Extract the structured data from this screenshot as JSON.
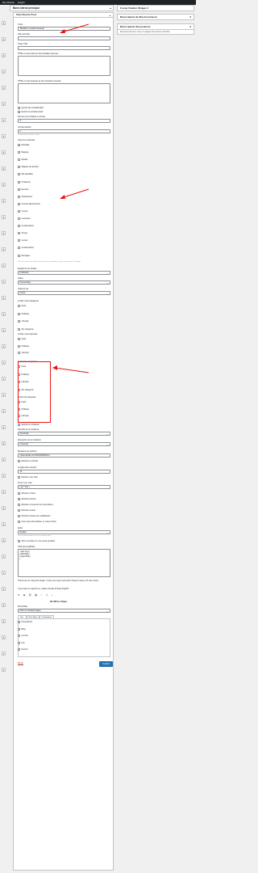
{
  "adminbar": {
    "items": [
      "Mis Librerías",
      "Analytic"
    ]
  },
  "left_icons": [
    {
      "glyph": "▾"
    },
    {
      "glyph": "▾"
    },
    {
      "glyph": "▾"
    }
  ],
  "area": {
    "title": "Barra lateral principal"
  },
  "widget": {
    "title": "Smart Recent Posts",
    "titulo_label": "Título",
    "titulo_value": "También te puede interesar",
    "url_label": "URL del título",
    "css_label": "Clase CSS",
    "html_before_label": "HTML o texto antes de las entradas recientes",
    "html_after_label": "HTML o texto después de las entradas recientes",
    "ignore_sticky": "Ignorar las entradas fijas",
    "exclude_current": "Excluir la entrada actual",
    "num_label": "Número de entradas a mostrar",
    "num_value": "5",
    "offset_label": "Compensación",
    "offset_value": "0",
    "offset_hint": "El número de entradas a omitir",
    "types_label": "Tipos de contenido",
    "types": [
      {
        "label": "Entradas",
        "checked": true
      },
      {
        "label": "Páginas",
        "checked": false
      },
      {
        "label": "Medios",
        "checked": false
      },
      {
        "label": "Páginas de destino",
        "checked": false
      },
      {
        "label": "Mis plantillas",
        "checked": false
      },
      {
        "label": "Productos",
        "checked": false
      },
      {
        "label": "Eventos",
        "checked": false
      },
      {
        "label": "Ubicaciones",
        "checked": false
      },
      {
        "label": "Correos Electrónicos",
        "checked": false
      },
      {
        "label": "Cursos",
        "checked": false
      },
      {
        "label": "Lecciones",
        "checked": false
      },
      {
        "label": "Cuestionarios",
        "checked": false
      },
      {
        "label": "Temas",
        "checked": false
      },
      {
        "label": "Cursos",
        "checked": false
      },
      {
        "label": "Cuestionarios",
        "checked": false
      },
      {
        "label": "Mensajes",
        "checked": false
      }
    ],
    "types_hint": "Por favor, selecciona alguno de los tipos de contenido para que se muestre en el widget",
    "status_label": "Estado de la entrada",
    "status_value": "Publicado",
    "order_label": "Orden",
    "order_value": "Descending",
    "orderby_label": "Ordenar por",
    "orderby_value": "Fecha",
    "limit_cat_label": "Limitar a las categorías",
    "limit_cats": [
      {
        "label": "Food"
      },
      {
        "label": "Holidays"
      },
      {
        "label": "Lifestyle"
      },
      {
        "label": "Sin categoría"
      }
    ],
    "limit_tag_label": "Limitar a las etiquetas",
    "limit_tags": [
      {
        "label": "Food"
      },
      {
        "label": "Holidays"
      },
      {
        "label": "Lifestyle"
      }
    ],
    "excl_cat_label": "Excluir las categorías",
    "excl_cats": [
      {
        "label": "Food"
      },
      {
        "label": "Holidays"
      },
      {
        "label": "Lifestyle"
      },
      {
        "label": "Sin categoría"
      }
    ],
    "excl_tag_label": "Excluir las etiquetas",
    "excl_tags": [
      {
        "label": "Food"
      },
      {
        "label": "Holidays"
      },
      {
        "label": "Lifestyle"
      }
    ],
    "show_thumb": "Mostrar la miniatura",
    "thumb_size_label": "Tamaño de la miniatura",
    "thumb_size_value": "thumbnail",
    "thumb_align_label": "Alineación de la miniatura",
    "thumb_align_value": "Izquierda",
    "default_thumb_label": "Miniatura por defecto",
    "default_thumb_value": "//placeholdit.com/45x45/f0f0f0/ccc",
    "show_excerpt": "Mostrar el extracto",
    "excerpt_len_label": "Longitud del extracto",
    "excerpt_len_value": "10",
    "show_readmore": "Mostrar 'Leer más'",
    "readmore_label": "Texto 'Leer más'",
    "readmore_value": "Leer más »",
    "show_date": "Mostrar el título",
    "show_fecha": "Mostrar la fecha",
    "show_comments": "Mostrar el recuento de comentarios",
    "show_author": "Mostrar el autor",
    "show_modified": "Mostrar la fecha de modificación",
    "relative_date": "Usa una fecha relativa: ej. 'hace 5 días'",
    "style_label": "Estilo",
    "style_value": "Default",
    "style_hint": "Usa el estilo por defecto o crea tu propio estilo",
    "new_window": "Abrir el enlace en una nueva pestaña",
    "css_custom_label": "CSS personalizado",
    "css_custom_value": ".wpsr-img {\nwidth:50px;\nheight:50px;\n}",
    "thanks_text": "Thank you for using this plugin. I hope you enjoy it and don't forget to leave a 5 star review.",
    "support_text": "If you want to support me, please donate through PayPal.",
    "sub_widget_title": "WordPress Pages",
    "show_label": "Show/Hide",
    "show_value": "Hide on checked pages",
    "tabs": [
      {
        "label": "Misc"
      },
      {
        "label": "Post Types"
      },
      {
        "label": "Taxonomies"
      }
    ],
    "pages": [
      {
        "label": "Home/Posts"
      },
      {
        "label": "Blog"
      },
      {
        "label": "Lin-lofo"
      },
      {
        "label": "Info"
      },
      {
        "label": "Search"
      }
    ],
    "delete_label": "Borrar",
    "save_label": "Guardar"
  },
  "right": {
    "footer_title": "Footer Builder Widget 3",
    "woo_title": "Barra lateral de WooCommerce",
    "product_title": "Barra lateral del producto",
    "product_desc": "Esta barra lateral se usa en la página del producto individual"
  },
  "colors": {
    "annotation": "#e11111",
    "accent": "#2271b1"
  }
}
